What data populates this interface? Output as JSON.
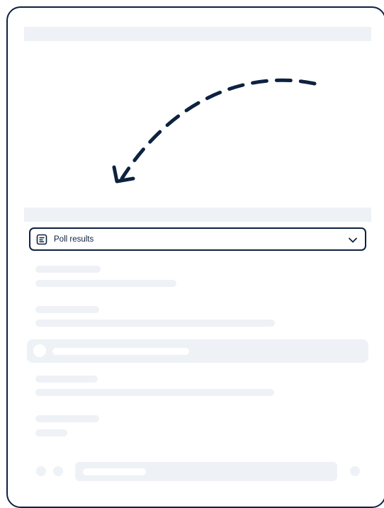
{
  "dropdown": {
    "label": "Poll results",
    "icon": "list-icon",
    "chevron": "chevron-down-icon"
  },
  "colors": {
    "accent": "#0d2240",
    "skeleton": "#eef1f6"
  }
}
